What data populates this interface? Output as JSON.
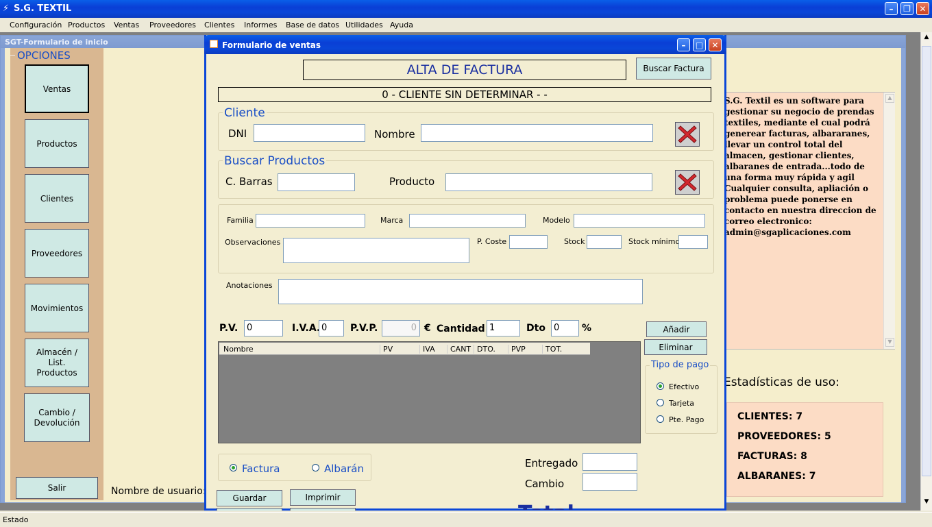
{
  "app": {
    "title": "S.G. TEXTIL"
  },
  "menubar": [
    "Configuración",
    "Productos",
    "Ventas",
    "Proveedores",
    "Clientes",
    "Informes",
    "Base de datos",
    "Utilidades",
    "Ayuda"
  ],
  "inicio": {
    "title": "SGT-Formulario de inicio",
    "opciones_label": "OPCIONES",
    "side_buttons": [
      "Ventas",
      "Productos",
      "Clientes",
      "Proveedores",
      "Movimientos",
      "Almacén / List. Productos",
      "Cambio / Devolución"
    ],
    "salir": "Salir",
    "username_label": "Nombre de usuario: A",
    "info_text": "S.G. Textil es un software para gestionar su negocio de prendas textiles, mediante el cual podrá generear facturas, albararanes, llevar un control total del almacen, gestionar clientes, albaranes de entrada...todo de una forma muy rápida y agil\nCualquier consulta, apliación o problema puede ponerse en contacto en nuestra direccion de correo electronico: admin@sgaplicaciones.com",
    "stats_title": "Estadísticas de uso:",
    "stats": [
      "CLIENTES: 7",
      "PROVEEDORES: 5",
      "FACTURAS: 8",
      "ALBARANES: 7"
    ]
  },
  "ventas": {
    "title": "Formulario de ventas",
    "header": "ALTA DE FACTURA",
    "buscar_factura": "Buscar Factura",
    "cliente_bar": "0 - CLIENTE SIN DETERMINAR - -",
    "cliente_group": "Cliente",
    "dni_label": "DNI",
    "nombre_label": "Nombre",
    "buscar_group": "Buscar Productos",
    "cbarras_label": "C. Barras",
    "producto_label": "Producto",
    "familia_label": "Familia",
    "marca_label": "Marca",
    "modelo_label": "Modelo",
    "observaciones_label": "Observaciones",
    "pcoste_label": "P. Coste",
    "stock_label": "Stock",
    "stockmin_label": "Stock mínimo",
    "anotaciones_label": "Anotaciones",
    "pv_label": "P.V.",
    "pv_value": "0",
    "iva_label": "I.V.A.",
    "iva_value": "0",
    "pvp_label": "P.V.P.",
    "pvp_value": "0",
    "euro": "€",
    "cantidad_label": "Cantidad",
    "cantidad_value": "1",
    "dto_label": "Dto",
    "dto_value": "0",
    "percent": "%",
    "anadir": "Añadir",
    "eliminar": "Eliminar",
    "grid_columns": [
      "Nombre",
      "PV",
      "IVA",
      "CANT",
      "DTO.",
      "PVP",
      "TOT."
    ],
    "tipo_pago": "Tipo de pago",
    "pago_options": [
      "Efectivo",
      "Tarjeta",
      "Pte. Pago"
    ],
    "doc_options": [
      "Factura",
      "Albarán"
    ],
    "entregado_label": "Entregado",
    "cambio_label": "Cambio",
    "guardar": "Guardar",
    "imprimir": "Imprimir",
    "total_label": "Total"
  },
  "status": {
    "text": "Estado"
  }
}
